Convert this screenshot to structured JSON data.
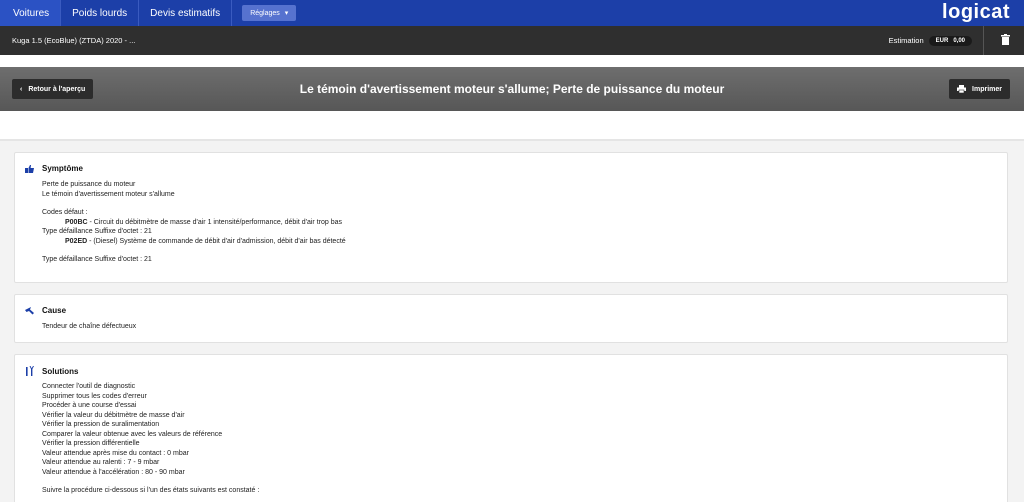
{
  "nav": {
    "tabs": [
      "Voitures",
      "Poids lourds",
      "Devis estimatifs"
    ],
    "settings_label": "Réglages",
    "logo": "logicat"
  },
  "vehicle": {
    "name": "Kuga 1.5 (EcoBlue) (ZTDA) 2020 - ...",
    "estimation_label": "Estimation",
    "currency": "EUR",
    "amount": "0,00"
  },
  "titlebar": {
    "back_label": "Retour à l'aperçu",
    "title": "Le témoin d'avertissement moteur s'allume; Perte de puissance du moteur",
    "print_label": "Imprimer"
  },
  "symptom": {
    "title": "Symptôme",
    "lines": [
      "Perte de puissance du moteur",
      "Le témoin d'avertissement moteur s'allume"
    ],
    "codes_label": "Codes défaut :",
    "codes": [
      {
        "code": "P00BC",
        "desc": " - Circuit du débitmètre de masse d'air 1 intensité/performance, débit d'air trop bas"
      },
      {
        "code": "P02ED",
        "desc": " - (Diesel) Système de commande de débit d'air d'admission, débit d'air bas détecté"
      }
    ],
    "failure_types": [
      "Type défaillance Suffixe d'octet : 21",
      "Type défaillance Suffixe d'octet : 21"
    ]
  },
  "cause": {
    "title": "Cause",
    "text": "Tendeur de chaîne défectueux"
  },
  "solutions": {
    "title": "Solutions",
    "lines": [
      "Connecter l'outil de diagnostic",
      "Supprimer tous les codes d'erreur",
      "Procéder à une course d'essai",
      "Vérifier la valeur du débitmètre de masse d'air",
      "Vérifier la pression de suralimentation",
      "Comparer la valeur obtenue avec les valeurs de référence",
      "Vérifier la pression différentielle",
      "Valeur attendue après mise du contact : 0 mbar",
      "Valeur attendue au ralenti : 7 - 9 mbar",
      "Valeur attendue à l'accélération : 80 - 90 mbar"
    ],
    "followup": "Suivre la procédure ci-dessous si l'un des états suivants est constaté :"
  },
  "colors": {
    "nav_bg": "#1c3fa8",
    "vehicle_bar_bg": "#2f2f2f",
    "title_bar_bg": "#636363",
    "icon_blue": "#1c3fa8"
  }
}
